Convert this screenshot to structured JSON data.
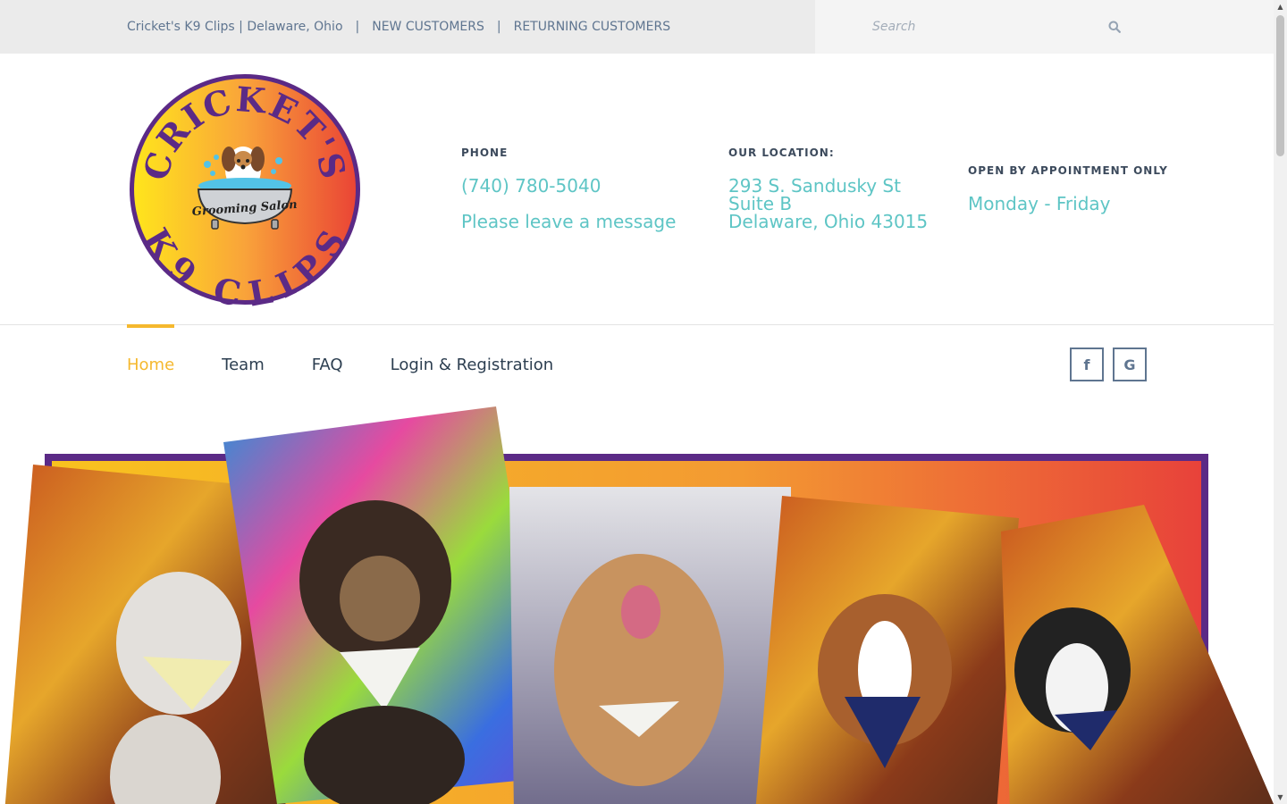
{
  "topbar": {
    "site_label": "Cricket's K9 Clips | Delaware, Ohio",
    "separator": "|",
    "new_customers": "NEW CUSTOMERS",
    "returning_customers": "RETURNING CUSTOMERS",
    "search_placeholder": "Search",
    "search_icon": "search-icon"
  },
  "logo": {
    "top_text": "CRICKET'S",
    "bottom_text": "K9 CLIPS",
    "center_text": "Grooming Salon",
    "colors": {
      "ring": "#5b2a86",
      "gradient_start": "#ffd21f",
      "gradient_end": "#ee4b35"
    }
  },
  "contact": {
    "phone_label": "PHONE",
    "phone_number": "(740) 780-5040",
    "phone_note": "Please leave a message",
    "location_label": "OUR LOCATION:",
    "address_line1": "293 S. Sandusky St",
    "address_line2": "Suite B",
    "address_line3": "Delaware, Ohio 43015",
    "hours_label": "OPEN BY APPOINTMENT ONLY",
    "hours_value": "Monday - Friday"
  },
  "nav": {
    "items": [
      {
        "label": "Home",
        "active": true
      },
      {
        "label": "Team",
        "active": false
      },
      {
        "label": "FAQ",
        "active": false
      },
      {
        "label": "Login & Registration",
        "active": false
      }
    ],
    "social": [
      {
        "icon": "facebook-icon",
        "glyph": "f"
      },
      {
        "icon": "google-icon",
        "glyph": "G"
      }
    ]
  },
  "hero": {
    "description_icons": [
      "dog-photo-collage"
    ],
    "frame_colors": {
      "border": "#5b2a86",
      "gradient_start": "#f7b52a",
      "gradient_end": "#e8423a"
    }
  },
  "colors": {
    "accent": "#5ec5c5",
    "active_nav": "#f5b82e",
    "text_dark": "#2c3e50",
    "muted": "#5f7590"
  }
}
